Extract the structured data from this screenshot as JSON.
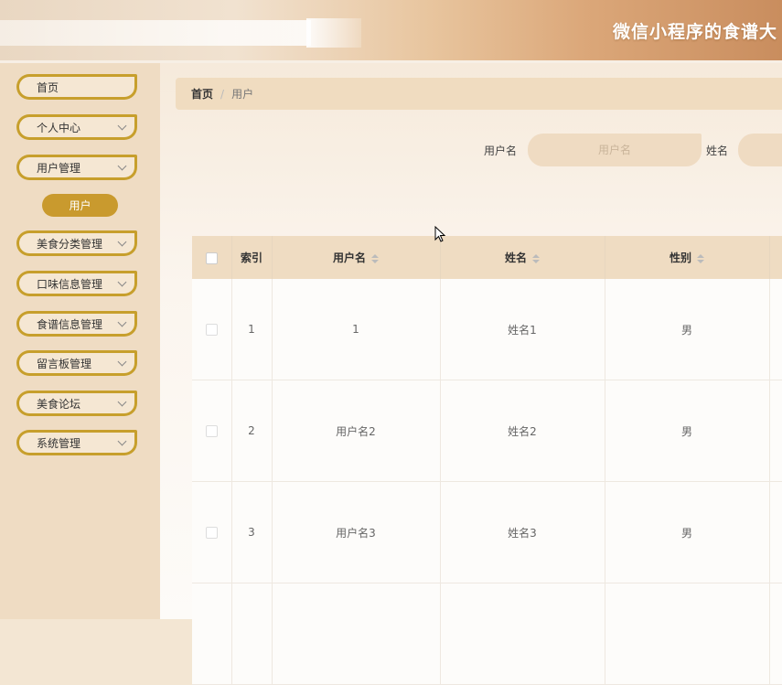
{
  "header": {
    "title": "微信小程序的食谱大"
  },
  "sidebar": {
    "items": [
      {
        "label": "首页",
        "has_arrow": false
      },
      {
        "label": "个人中心",
        "has_arrow": true
      },
      {
        "label": "用户管理",
        "has_arrow": true
      },
      {
        "label": "美食分类管理",
        "has_arrow": true
      },
      {
        "label": "口味信息管理",
        "has_arrow": true
      },
      {
        "label": "食谱信息管理",
        "has_arrow": true
      },
      {
        "label": "留言板管理",
        "has_arrow": true
      },
      {
        "label": "美食论坛",
        "has_arrow": true
      },
      {
        "label": "系统管理",
        "has_arrow": true
      }
    ],
    "active_submenu": "用户"
  },
  "breadcrumb": {
    "home": "首页",
    "separator": "/",
    "current": "用户"
  },
  "search": {
    "username_label": "用户名",
    "username_placeholder": "用户名",
    "name_label": "姓名"
  },
  "table": {
    "columns": [
      "索引",
      "用户名",
      "姓名",
      "性别"
    ],
    "rows": [
      {
        "index": "1",
        "username": "1",
        "name": "姓名1",
        "gender": "男"
      },
      {
        "index": "2",
        "username": "用户名2",
        "name": "姓名2",
        "gender": "男"
      },
      {
        "index": "3",
        "username": "用户名3",
        "name": "姓名3",
        "gender": "男"
      }
    ]
  },
  "colors": {
    "accent": "#c79f2c",
    "header_bg": "#efdcc2",
    "sidebar_bg": "#efdcc3"
  }
}
